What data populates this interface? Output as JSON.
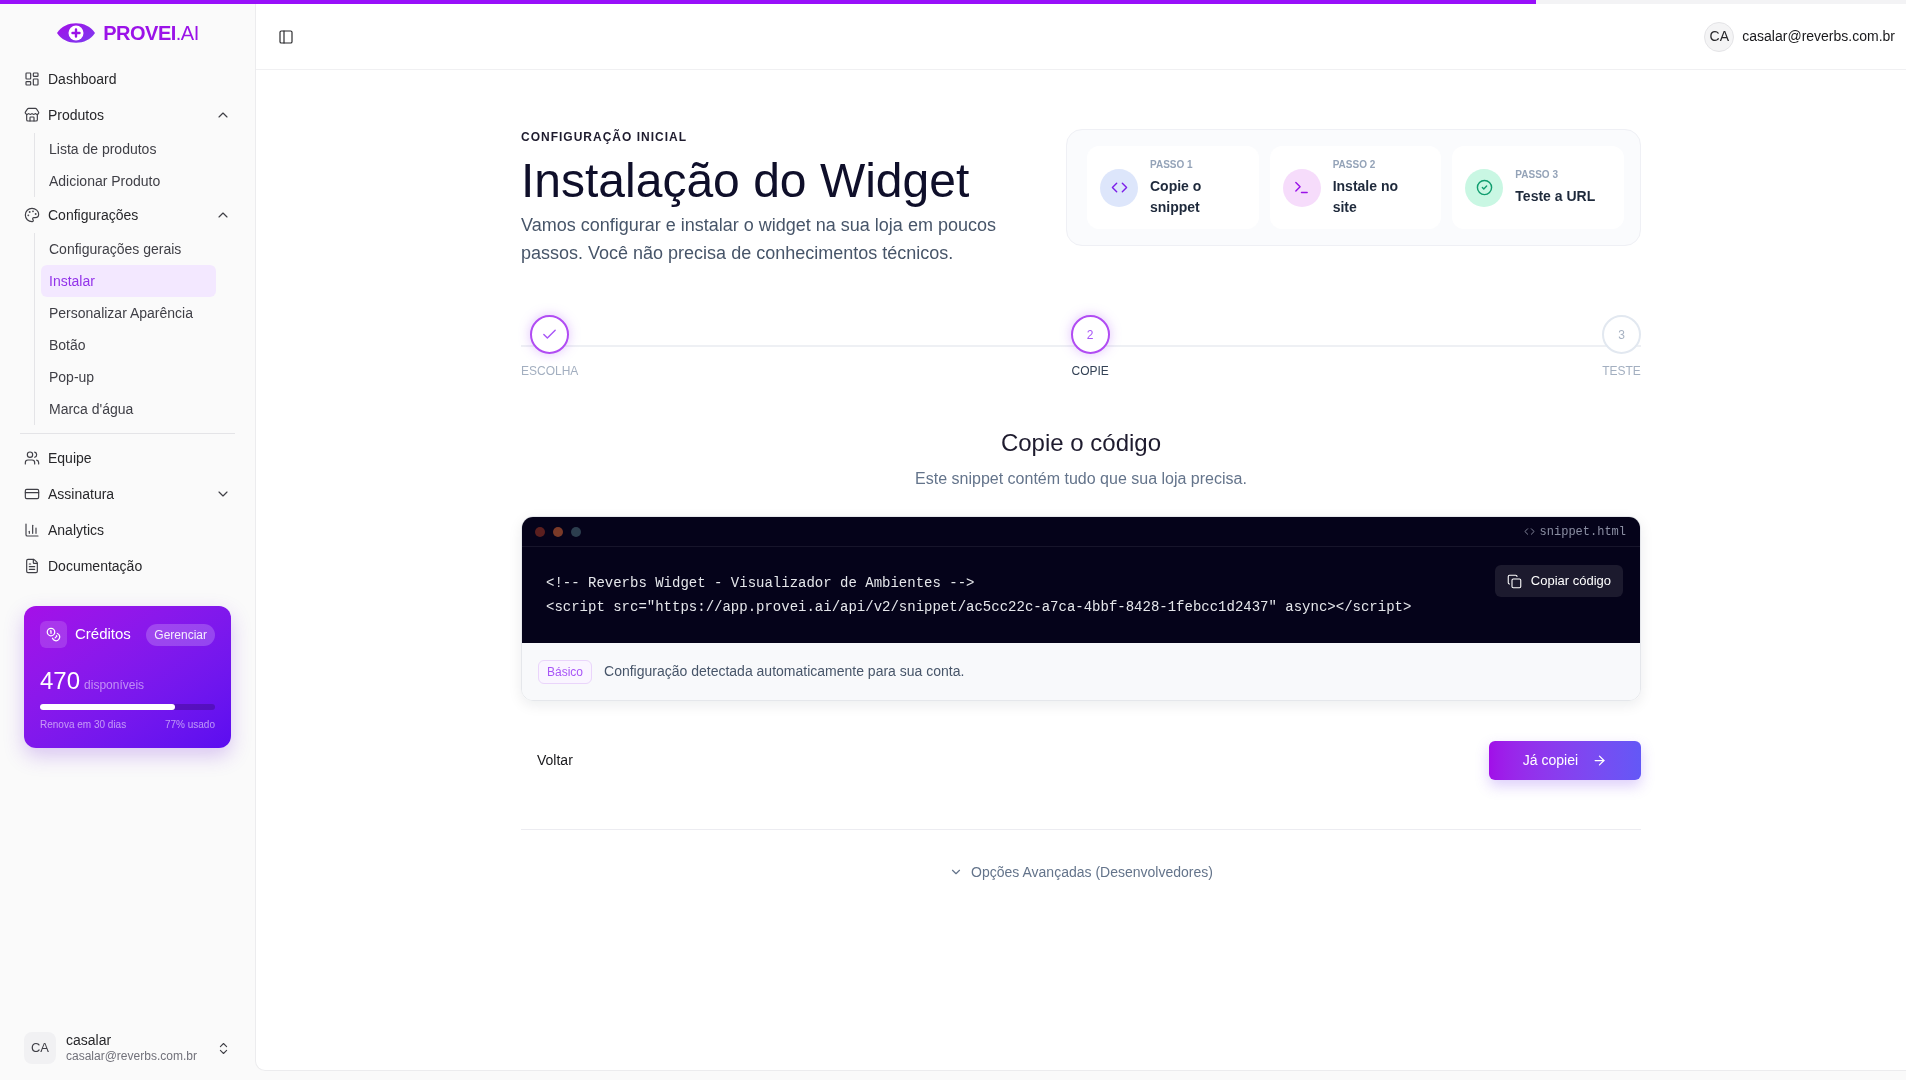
{
  "top_progress": {
    "level": 0.806
  },
  "sidebar": {
    "logo": "**PROVEI**.AI",
    "sections": [
      {
        "items": [
          {
            "label": "Dashboard",
            "selected": false
          },
          {
            "label": "Produtos",
            "selected": false,
            "expanded": true,
            "children": [
              {
                "label": "Lista de produtos",
                "selected": false
              },
              {
                "label": "Adicionar Produto",
                "selected": false
              }
            ]
          },
          {
            "label": "Configurações",
            "selected": false,
            "expanded": true,
            "children": [
              {
                "label": "Configurações gerais",
                "selected": false
              },
              {
                "label": "Instalar",
                "selected": true
              },
              {
                "label": "Personalizar Aparência",
                "selected": false
              },
              {
                "label": "Botão",
                "selected": false
              },
              {
                "label": "Pop-up",
                "selected": false
              },
              {
                "label": "Marca d'água",
                "selected": false
              }
            ]
          }
        ]
      },
      {
        "items": [
          {
            "label": "Equipe",
            "selected": false
          },
          {
            "label": "Assinatura",
            "selected": false,
            "expanded": false
          },
          {
            "label": "Analytics",
            "selected": false
          },
          {
            "label": "Documentação",
            "selected": false
          }
        ]
      }
    ],
    "credits": {
      "title": "Créditos",
      "action": "Gerenciar",
      "amount": "470",
      "unit": "disponíveis",
      "level": 0.77,
      "renewal": "Renova em 30 dias",
      "usage": "77% usado"
    },
    "user": {
      "initials": "CA",
      "name": "casalar",
      "email": "casalar@reverbs.com.br"
    }
  },
  "header": {
    "user": {
      "initials": "CA",
      "email": "casalar@reverbs.com.br"
    }
  },
  "intro": {
    "eyebrow": "CONFIGURAÇÃO INICIAL",
    "title": "Instalação do Widget",
    "description": "Vamos configurar e instalar o widget na sua loja em poucos passos. Você não precisa de conhecimentos técnicos."
  },
  "overview_steps": [
    {
      "label": "PASSO 1",
      "title": "Copie o snippet"
    },
    {
      "label": "PASSO 2",
      "title": "Instale no site"
    },
    {
      "label": "PASSO 3",
      "title": "Teste a URL"
    }
  ],
  "stepper": [
    {
      "label": "ESCOLHA",
      "completed": true,
      "selected": false
    },
    {
      "label": "COPIE",
      "number": "2",
      "completed": false,
      "selected": true
    },
    {
      "label": "TESTE",
      "number": "3",
      "completed": false,
      "selected": false
    }
  ],
  "section": {
    "title": "Copie o código",
    "subtitle": "Este snippet contém tudo que sua loja precisa."
  },
  "snippet": {
    "filename": "snippet.html",
    "lines": [
      "<!-- Reverbs Widget - Visualizador de Ambientes -->",
      "<script src=\"https://app.provei.ai/api/v2/snippet/ac5cc22c-a7ca-4bbf-8428-1febcc1d2437\" async></script>"
    ],
    "copy_button": "Copiar código",
    "badge": "Básico",
    "note": "Configuração detectada automaticamente para sua conta."
  },
  "actions": {
    "back": "Voltar",
    "next": "Já copiei"
  },
  "advanced": {
    "label": "Opções Avançadas (Desenvolvedores)",
    "expanded": false
  }
}
